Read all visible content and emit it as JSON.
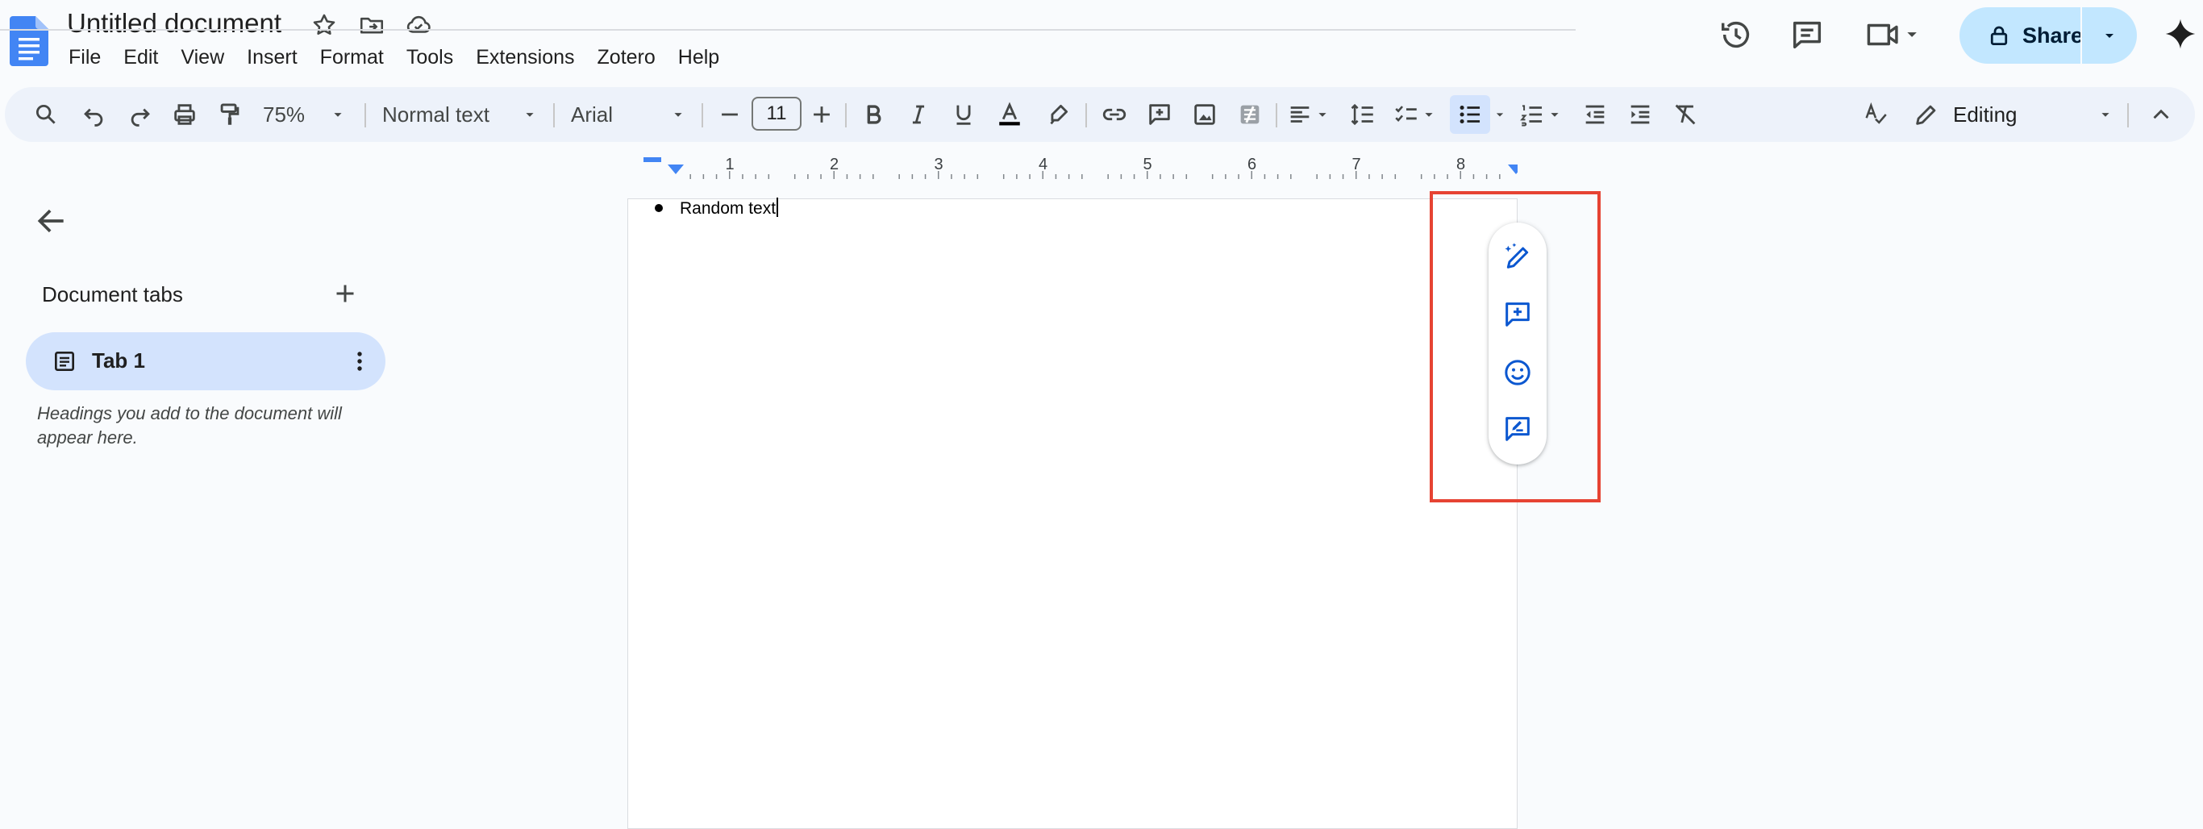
{
  "document": {
    "title": "Untitled document",
    "body_lines": [
      "Random text"
    ]
  },
  "menu": [
    "File",
    "Edit",
    "View",
    "Insert",
    "Format",
    "Tools",
    "Extensions",
    "Zotero",
    "Help"
  ],
  "share": {
    "label": "Share"
  },
  "toolbar": {
    "zoom": "75%",
    "style": "Normal text",
    "font": "Arial",
    "font_size": "11",
    "mode": "Editing"
  },
  "ruler": {
    "numbers": [
      "1",
      "2",
      "3",
      "4",
      "5",
      "6",
      "7",
      "8"
    ]
  },
  "sidebar": {
    "heading": "Document tabs",
    "tabs": [
      {
        "label": "Tab 1"
      }
    ],
    "hint": "Headings you add to the document will appear here."
  },
  "colors": {
    "accent": "#0b57d0",
    "share_bg": "#c2e7ff",
    "tab_active_bg": "#d3e3fd",
    "toolbar_bg": "#edf2fa",
    "highlight": "#e64333"
  }
}
